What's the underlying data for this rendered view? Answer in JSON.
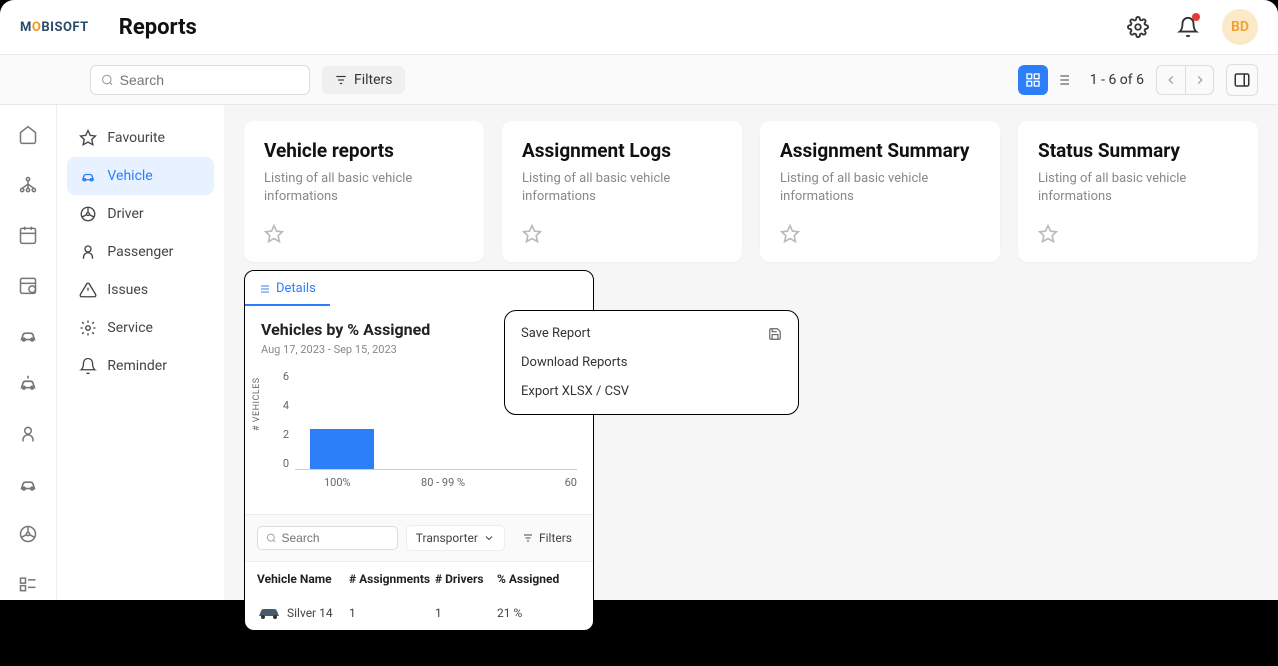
{
  "header": {
    "logo_pre": "M",
    "logo_o": "O",
    "logo_post": "BISOFT",
    "title": "Reports",
    "avatar": "BD"
  },
  "toolbar": {
    "search_placeholder": "Search",
    "filters_label": "Filters",
    "pager": "1 - 6 of 6"
  },
  "sidebar": {
    "items": [
      {
        "label": "Favourite"
      },
      {
        "label": "Vehicle"
      },
      {
        "label": "Driver"
      },
      {
        "label": "Passenger"
      },
      {
        "label": "Issues"
      },
      {
        "label": "Service"
      },
      {
        "label": "Reminder"
      }
    ]
  },
  "cards": [
    {
      "title": "Vehicle reports",
      "desc": "Listing of all basic vehicle informations"
    },
    {
      "title": "Assignment Logs",
      "desc": "Listing of all basic vehicle informations"
    },
    {
      "title": "Assignment Summary",
      "desc": "Listing of all basic vehicle informations"
    },
    {
      "title": "Status Summary",
      "desc": "Listing of all basic vehicle informations"
    }
  ],
  "detail": {
    "tab": "Details",
    "chart_title": "Vehicles by % Assigned",
    "chart_date": "Aug 17, 2023 - Sep 15, 2023",
    "search_placeholder": "Search",
    "transporter": "Transporter",
    "filters": "Filters",
    "cols": [
      "Vehicle Name",
      "# Assignments",
      "# Drivers",
      "% Assigned"
    ],
    "row": {
      "name": "Silver 14",
      "assign": "1",
      "drivers": "1",
      "pct": "21 %"
    }
  },
  "ctx": [
    "Save Report",
    "Download Reports",
    "Export XLSX / CSV"
  ],
  "chart_data": {
    "type": "bar",
    "title": "Vehicles by % Assigned",
    "ylabel": "# VEHICLES",
    "yticks": [
      6,
      4,
      2,
      0
    ],
    "ylim": [
      0,
      6
    ],
    "categories": [
      "100%",
      "80 - 99 %",
      "60"
    ],
    "values": [
      2.4,
      0,
      0
    ]
  }
}
